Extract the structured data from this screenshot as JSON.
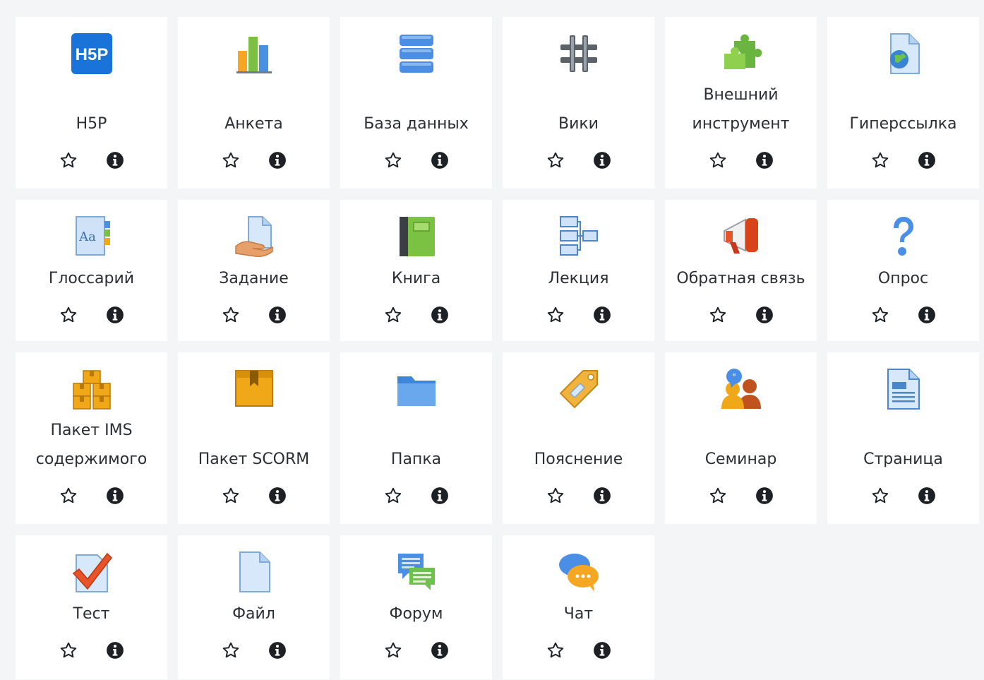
{
  "activities": [
    {
      "name": "H5P",
      "icon": "h5p-icon"
    },
    {
      "name": "Анкета",
      "icon": "survey-icon"
    },
    {
      "name": "База данных",
      "icon": "database-icon"
    },
    {
      "name": "Вики",
      "icon": "wiki-icon"
    },
    {
      "name": "Внешний инструмент",
      "line1": "Внешний",
      "line2": "инструмент",
      "icon": "external-tool-icon"
    },
    {
      "name": "Гиперссылка",
      "icon": "url-icon"
    },
    {
      "name": "Глоссарий",
      "icon": "glossary-icon"
    },
    {
      "name": "Задание",
      "icon": "assignment-icon"
    },
    {
      "name": "Книга",
      "icon": "book-icon"
    },
    {
      "name": "Лекция",
      "icon": "lesson-icon"
    },
    {
      "name": "Обратная связь",
      "icon": "feedback-icon"
    },
    {
      "name": "Опрос",
      "icon": "choice-icon"
    },
    {
      "name": "Пакет IMS содержимого",
      "line1": "Пакет IMS",
      "line2": "содержимого",
      "icon": "ims-package-icon"
    },
    {
      "name": "Пакет SCORM",
      "icon": "scorm-icon"
    },
    {
      "name": "Папка",
      "icon": "folder-icon"
    },
    {
      "name": "Пояснение",
      "icon": "label-icon"
    },
    {
      "name": "Семинар",
      "icon": "workshop-icon"
    },
    {
      "name": "Страница",
      "icon": "page-icon"
    },
    {
      "name": "Тест",
      "icon": "quiz-icon"
    },
    {
      "name": "Файл",
      "icon": "file-icon"
    },
    {
      "name": "Форум",
      "icon": "forum-icon"
    },
    {
      "name": "Чат",
      "icon": "chat-icon"
    }
  ],
  "colors": {
    "page_background": "#f4f5f6",
    "tile_background": "#ffffff",
    "action_icons": "#1d2125"
  }
}
